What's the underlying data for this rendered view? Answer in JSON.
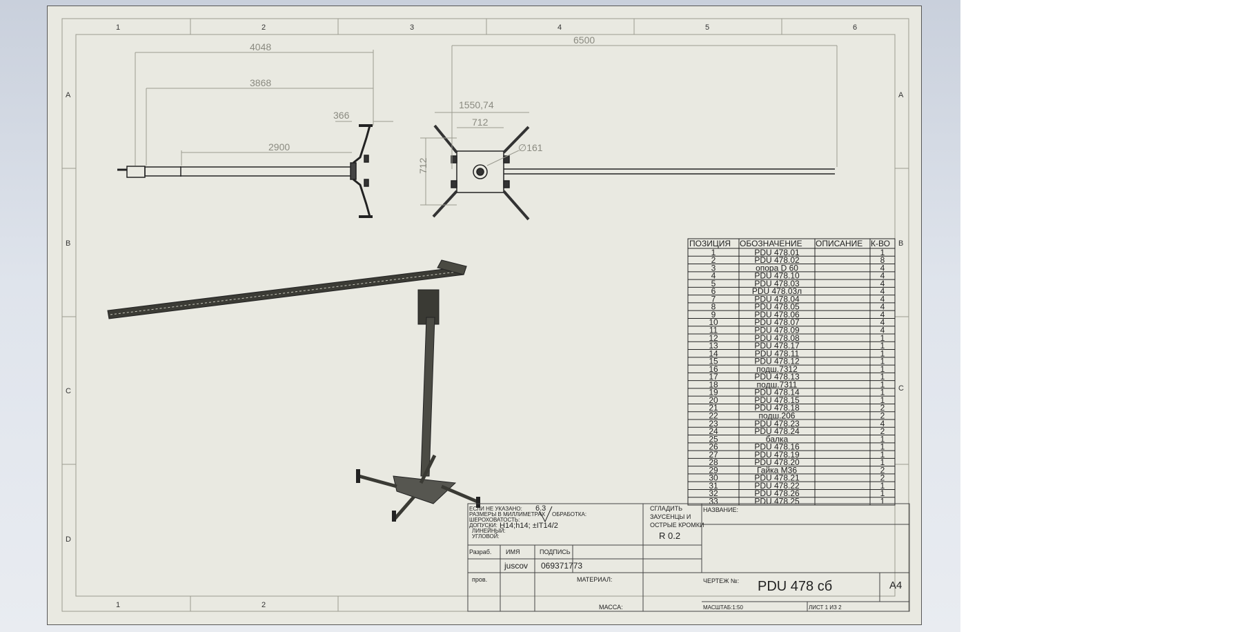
{
  "border": {
    "columns_top": [
      "1",
      "2",
      "3",
      "4",
      "5",
      "6"
    ],
    "columns_bottom": [
      "1",
      "2"
    ],
    "rows_left": [
      "A",
      "B",
      "C",
      "D"
    ],
    "rows_right": [
      "A",
      "B",
      "C"
    ]
  },
  "dimensions": {
    "d4048": "4048",
    "d3868": "3868",
    "d366": "366",
    "d2900": "2900",
    "d6500": "6500",
    "d1550": "1550,74",
    "d712h": "712",
    "d161": "∅161",
    "d712v": "712"
  },
  "bom": {
    "headers": [
      "ПОЗИЦИЯ",
      "ОБОЗНАЧЕНИЕ",
      "ОПИСАНИЕ",
      "К-ВО"
    ],
    "rows": [
      [
        "1",
        "PDU 478.01",
        "",
        "1"
      ],
      [
        "2",
        "PDU 478.02",
        "",
        "8"
      ],
      [
        "3",
        "опора D 60",
        "",
        "4"
      ],
      [
        "4",
        "PDU 478.10",
        "",
        "4"
      ],
      [
        "5",
        "PDU 478.03",
        "",
        "4"
      ],
      [
        "6",
        "PDU 478.03л",
        "",
        "4"
      ],
      [
        "7",
        "PDU 478.04",
        "",
        "4"
      ],
      [
        "8",
        "PDU 478.05",
        "",
        "4"
      ],
      [
        "9",
        "PDU 478.06",
        "",
        "4"
      ],
      [
        "10",
        "PDU 478.07",
        "",
        "4"
      ],
      [
        "11",
        "PDU 478.09",
        "",
        "4"
      ],
      [
        "12",
        "PDU 478.08",
        "",
        "1"
      ],
      [
        "13",
        "PDU 478.17",
        "",
        "1"
      ],
      [
        "14",
        "PDU 478.11",
        "",
        "1"
      ],
      [
        "15",
        "PDU 478.12",
        "",
        "1"
      ],
      [
        "16",
        "подш.7312",
        "",
        "1"
      ],
      [
        "17",
        "PDU 478.13",
        "",
        "1"
      ],
      [
        "18",
        "подш.7311",
        "",
        "1"
      ],
      [
        "19",
        "PDU 478.14",
        "",
        "1"
      ],
      [
        "20",
        "PDU 478.15",
        "",
        "1"
      ],
      [
        "21",
        "PDU 478.18",
        "",
        "2"
      ],
      [
        "22",
        "подш.206",
        "",
        "2"
      ],
      [
        "23",
        "PDU 478.23",
        "",
        "4"
      ],
      [
        "24",
        "PDU 478.24",
        "",
        "2"
      ],
      [
        "25",
        "балка",
        "",
        "1"
      ],
      [
        "26",
        "PDU 478.16",
        "",
        "1"
      ],
      [
        "27",
        "PDU 478.19",
        "",
        "1"
      ],
      [
        "28",
        "PDU 478.20",
        "",
        "1"
      ],
      [
        "29",
        "Гайка М36",
        "",
        "2"
      ],
      [
        "30",
        "PDU 478.21",
        "",
        "2"
      ],
      [
        "31",
        "PDU 478.22",
        "",
        "1"
      ],
      [
        "32",
        "PDU 478.26",
        "",
        "1"
      ],
      [
        "33",
        "PDU 478.25",
        "",
        "1"
      ]
    ]
  },
  "title_block": {
    "note_line1": "ЕСЛИ НЕ УКАЗАНО:",
    "note_line2": "РАЗМЕРЫ В МИЛЛИМЕТРАХ",
    "note_line3": "ШЕРОХОВАТОСТЬ:",
    "note_line4": "ДОПУСКИ:",
    "note_line5": "ЛИНЕЙНЫЙ:",
    "note_line6": "УГЛОВОЙ:",
    "roughness": "6.3",
    "finish_label": "ОБРАБОТКА:",
    "tolerance_value": "H14;h14; ±IT14/2",
    "deburr_line1": "СГЛАДИТЬ",
    "deburr_line2": "ЗАУСЕНЦЫ И",
    "deburr_line3": "ОСТРЫЕ КРОМКИ",
    "radius": "R 0.2",
    "name_label": "НАЗВАНИЕ:",
    "developed_label": "Разраб.",
    "name_col_label": "ИМЯ",
    "signature_label": "ПОДПИСЬ",
    "developer": "juscov",
    "signature_value": "069371773",
    "checked_label": "пров.",
    "material_label": "МАТЕРИАЛ:",
    "drawing_no_label": "ЧЕРТЕЖ №:",
    "drawing_no": "PDU 478  сб",
    "sheet_size": "A4",
    "mass_label": "МАССА:",
    "scale": "МАСШТАБ:1:50",
    "sheet_of": "ЛИСТ 1 ИЗ 2"
  }
}
